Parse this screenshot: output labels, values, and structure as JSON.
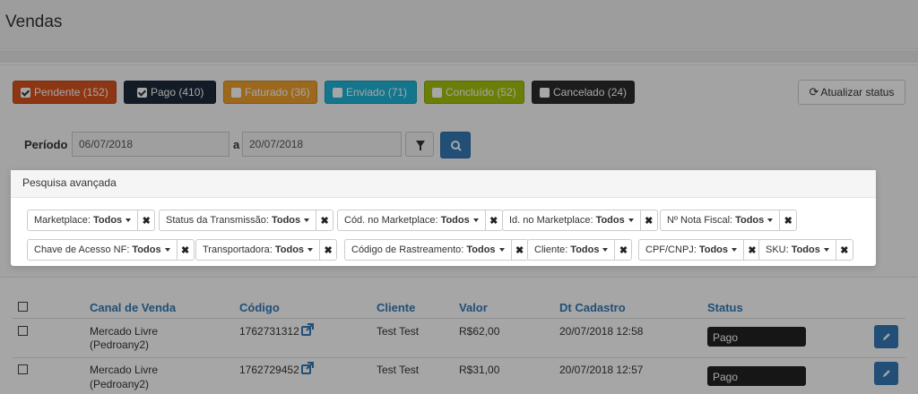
{
  "header": {
    "title": "Vendas"
  },
  "status_filters": [
    {
      "label": "Pendente (152)",
      "checked": true,
      "color": "#d9531e"
    },
    {
      "label": "Pago (410)",
      "checked": true,
      "color": "#1c2a3b"
    },
    {
      "label": "Faturado (36)",
      "checked": false,
      "color": "#f0a02e"
    },
    {
      "label": "Enviado (71)",
      "checked": false,
      "color": "#1fb5d9"
    },
    {
      "label": "Concluído (52)",
      "checked": false,
      "color": "#a5c20c"
    },
    {
      "label": "Cancelado (24)",
      "checked": false,
      "color": "#2b2b2b"
    }
  ],
  "refresh_label": "Atualizar status",
  "periodo": {
    "label": "Período",
    "from": "06/07/2018",
    "sep": "a",
    "to": "20/07/2018"
  },
  "advanced": {
    "title": "Pesquisa avançada",
    "chips": [
      {
        "label": "Marketplace:",
        "value": "Todos"
      },
      {
        "label": "Status da Transmissão:",
        "value": "Todos"
      },
      {
        "label": "Cód. no Marketplace:",
        "value": "Todos"
      },
      {
        "label": "Id. no Marketplace:",
        "value": "Todos"
      },
      {
        "label": "Nº Nota Fiscal:",
        "value": "Todos"
      },
      {
        "label": "Chave de Acesso NF:",
        "value": "Todos"
      },
      {
        "label": "Transportadora:",
        "value": "Todos"
      },
      {
        "label": "Código de Rastreamento:",
        "value": "Todos"
      },
      {
        "label": "Cliente:",
        "value": "Todos"
      },
      {
        "label": "CPF/CNPJ:",
        "value": "Todos"
      },
      {
        "label": "SKU:",
        "value": "Todos"
      }
    ]
  },
  "table": {
    "headers": [
      "Canal de Venda",
      "Código",
      "Cliente",
      "Valor",
      "Dt Cadastro",
      "Status"
    ],
    "rows": [
      {
        "canal_1": "Mercado Livre",
        "canal_2": "(Pedroany2)",
        "codigo": "1762731312",
        "cliente": "Test Test",
        "valor": "R$62,00",
        "dt": "20/07/2018 12:58",
        "status": "Pago"
      },
      {
        "canal_1": "Mercado Livre",
        "canal_2": "(Pedroany2)",
        "codigo": "1762729452",
        "cliente": "Test Test",
        "valor": "R$31,00",
        "dt": "20/07/2018 12:57",
        "status": "Pago"
      }
    ]
  },
  "icons": {
    "refresh": "refresh-icon",
    "filter": "filter-icon",
    "search": "search-icon",
    "remove": "remove-icon",
    "external": "external-link-icon",
    "edit": "pencil-icon"
  }
}
